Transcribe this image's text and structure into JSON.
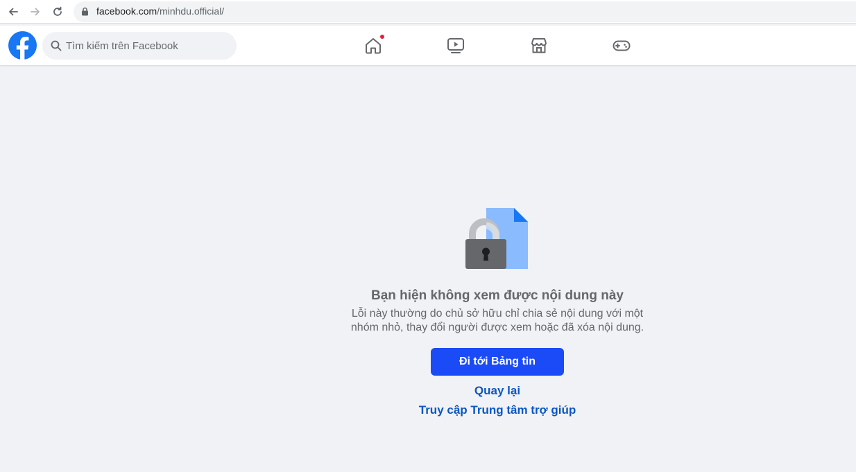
{
  "browser": {
    "url_domain": "facebook.com",
    "url_path": "/minhdu.official/"
  },
  "header": {
    "search_placeholder": "Tìm kiếm trên Facebook",
    "nav_icons": [
      "home-icon",
      "watch-icon",
      "marketplace-icon",
      "gaming-icon"
    ],
    "brand_color": "#1877f2",
    "notification_color": "#e41e3f"
  },
  "main": {
    "heading": "Bạn hiện không xem được nội dung này",
    "description_line1": "Lỗi này thường do chủ sở hữu chỉ chia sẻ nội dung với một",
    "description_line2": "nhóm nhỏ, thay đổi người được xem hoặc đã xóa nội dung.",
    "primary_button": "Đi tới Bảng tin",
    "back_link": "Quay lại",
    "help_link": "Truy cập Trung tâm trợ giúp",
    "button_color": "#1b4bf6",
    "link_color": "#0a56c2"
  }
}
